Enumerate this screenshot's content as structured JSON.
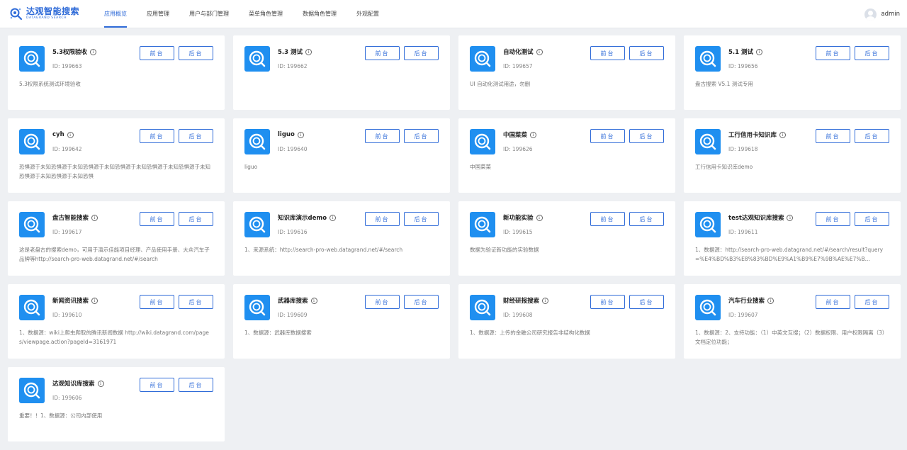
{
  "brand": {
    "name_cn": "达观智能搜索",
    "name_en": "DATAGRAND SEARCH",
    "color": "#2f6bd8"
  },
  "nav": [
    {
      "label": "应用概览",
      "active": true
    },
    {
      "label": "应用管理"
    },
    {
      "label": "用户与部门管理"
    },
    {
      "label": "菜单角色管理"
    },
    {
      "label": "数据角色管理"
    },
    {
      "label": "外观配置"
    }
  ],
  "user": {
    "name": "admin"
  },
  "buttons": {
    "front": "前台",
    "back": "后台"
  },
  "apps": [
    {
      "title": "5.3权限验收",
      "id": "ID: 199663",
      "desc": "5.3权限系统测试环境验收"
    },
    {
      "title": "5.3 测试",
      "id": "ID: 199662",
      "desc": ""
    },
    {
      "title": "自动化测试",
      "id": "ID: 199657",
      "desc": "UI 自动化测试用途，勿删"
    },
    {
      "title": "5.1 测试",
      "id": "ID: 199656",
      "desc": "盘古搜索 V5.1 测试专用"
    },
    {
      "title": "cyh",
      "id": "ID: 199642",
      "desc": "恐惧源于未知恐惧源于未知恐惧源于未知恐惧源于未知恐惧源于未知恐惧源于未知恐惧源于未知恐惧源于未知恐惧"
    },
    {
      "title": "liguo",
      "id": "ID: 199640",
      "desc": "liguo"
    },
    {
      "title": "中国菜菜",
      "id": "ID: 199626",
      "desc": "中国菜菜"
    },
    {
      "title": "工行信用卡知识库",
      "id": "ID: 199618",
      "desc": "工行信用卡知识库demo"
    },
    {
      "title": "盘古智能搜索",
      "id": "ID: 199617",
      "desc": "这是老盘古的搜索demo，可用于演示佳能项目经理、产品使用手册、大众汽车子品牌等http://search-pro-web.datagrand.net/#/search"
    },
    {
      "title": "知识库演示demo",
      "id": "ID: 199616",
      "desc": "1、来源系统：http://search-pro-web.datagrand.net/#/search"
    },
    {
      "title": "新功能实验",
      "id": "ID: 199615",
      "desc": "数据为验证新功能的实验数据"
    },
    {
      "title": "test达观知识库搜索",
      "id": "ID: 199611",
      "desc": "1、数据源：http://search-pro-web.datagrand.net/#/search/result?query=%E4%BD%B3%E8%83%BD%E9%A1%B9%E7%9B%AE%E7%B..."
    },
    {
      "title": "新闻资讯搜索",
      "id": "ID: 199610",
      "desc": "1、数据源：wiki上爬虫爬取的腾讯新闻数据 http://wiki.datagrand.com/pages/viewpage.action?pageId=3161971"
    },
    {
      "title": "武器库搜索",
      "id": "ID: 199609",
      "desc": "1、数据源：武器库数据搜索"
    },
    {
      "title": "财经研报搜索",
      "id": "ID: 199608",
      "desc": "1、数据源：上传的金融公司研究报告非结构化数据"
    },
    {
      "title": "汽车行业搜索",
      "id": "ID: 199607",
      "desc": "1、数据源：2、支持功能：（1）中英文互搜；（2）数据权限、用户权限隔离（3）文档定位功能；"
    },
    {
      "title": "达观知识库搜索",
      "id": "ID: 199606",
      "desc": "重要！！1、数据源：公司内部使用"
    }
  ]
}
